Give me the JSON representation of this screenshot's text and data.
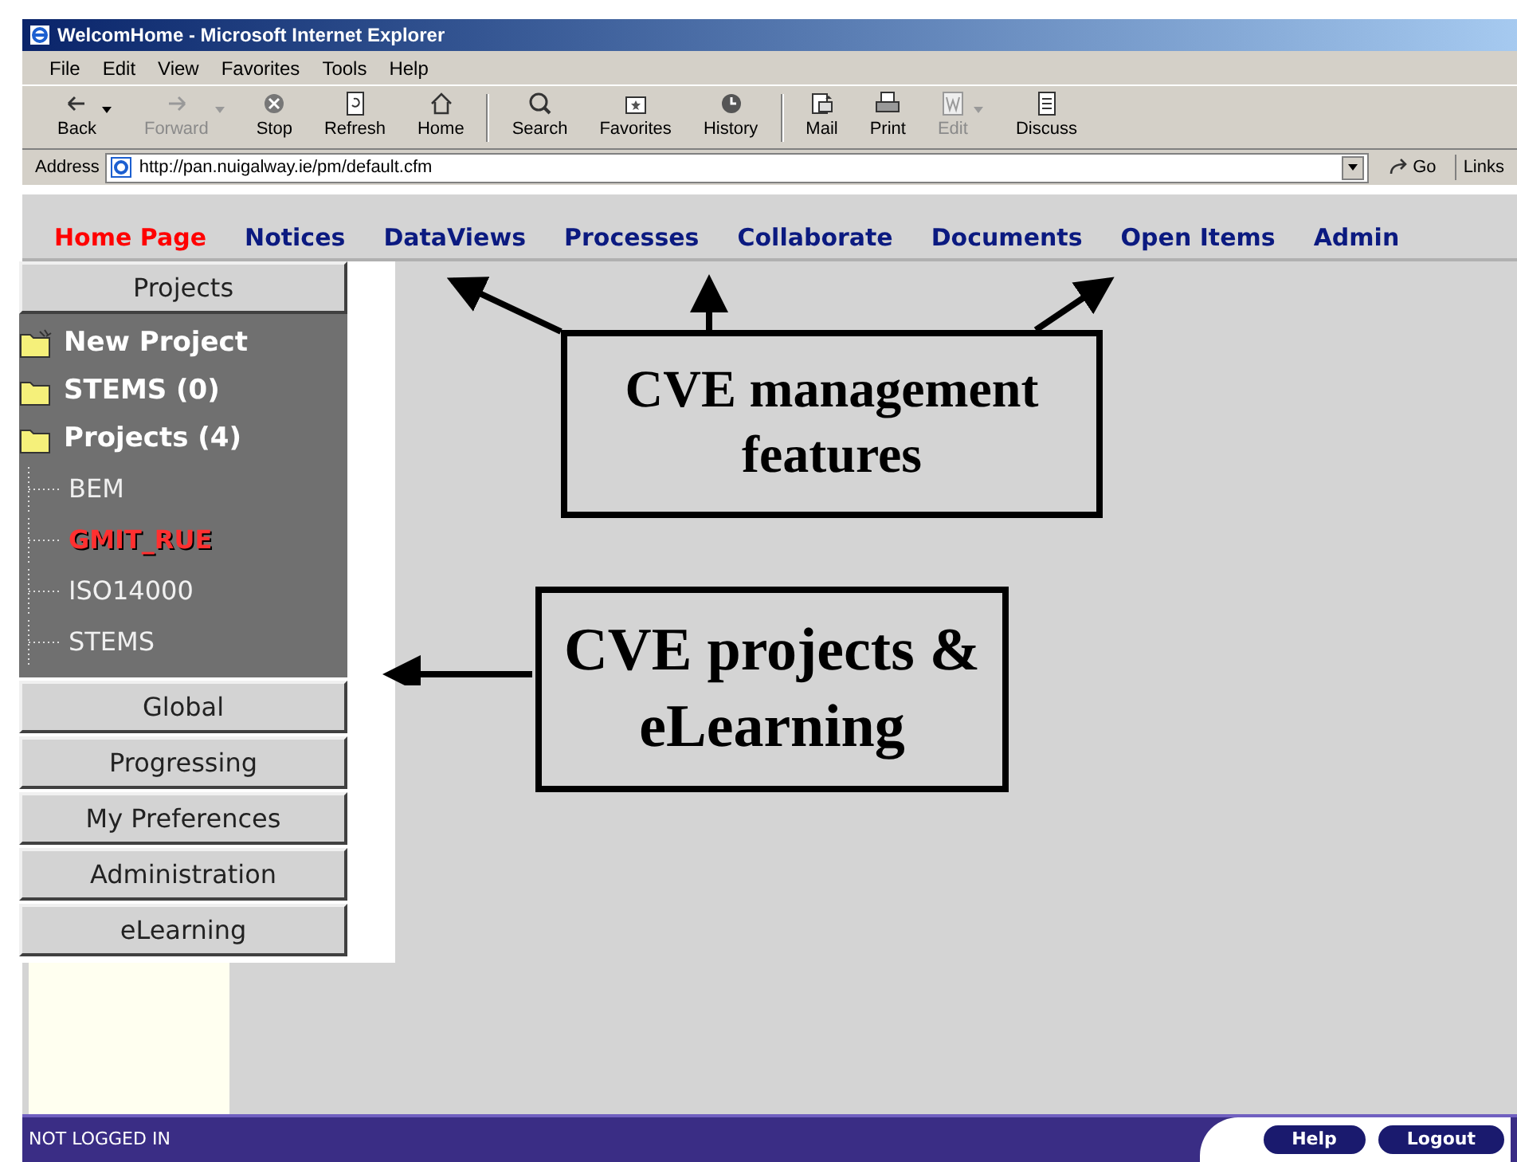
{
  "window": {
    "title": "WelcomHome - Microsoft Internet Explorer"
  },
  "menu": [
    "File",
    "Edit",
    "View",
    "Favorites",
    "Tools",
    "Help"
  ],
  "toolbar": [
    {
      "label": "Back",
      "kind": "back",
      "disabled": false,
      "dropdown": true
    },
    {
      "label": "Forward",
      "kind": "forward",
      "disabled": true,
      "dropdown": true
    },
    {
      "label": "Stop",
      "kind": "stop",
      "disabled": false,
      "dropdown": false
    },
    {
      "label": "Refresh",
      "kind": "refresh",
      "disabled": false,
      "dropdown": false
    },
    {
      "label": "Home",
      "kind": "home",
      "disabled": false,
      "dropdown": false
    },
    {
      "label": "Search",
      "kind": "search",
      "disabled": false,
      "dropdown": false
    },
    {
      "label": "Favorites",
      "kind": "favorites",
      "disabled": false,
      "dropdown": false
    },
    {
      "label": "History",
      "kind": "history",
      "disabled": false,
      "dropdown": false
    },
    {
      "label": "Mail",
      "kind": "mail",
      "disabled": false,
      "dropdown": false
    },
    {
      "label": "Print",
      "kind": "print",
      "disabled": false,
      "dropdown": false
    },
    {
      "label": "Edit",
      "kind": "edit",
      "disabled": true,
      "dropdown": true
    },
    {
      "label": "Discuss",
      "kind": "discuss",
      "disabled": false,
      "dropdown": false
    }
  ],
  "address": {
    "label": "Address",
    "value": "http://pan.nuigalway.ie/pm/default.cfm",
    "go": "Go",
    "links": "Links"
  },
  "nav": [
    {
      "label": "Home Page",
      "selected": true
    },
    {
      "label": "Notices",
      "selected": false
    },
    {
      "label": "DataViews",
      "selected": false
    },
    {
      "label": "Processes",
      "selected": false
    },
    {
      "label": "Collaborate",
      "selected": false
    },
    {
      "label": "Documents",
      "selected": false
    },
    {
      "label": "Open Items",
      "selected": false
    },
    {
      "label": "Admin",
      "selected": false
    }
  ],
  "sidebar": {
    "header": "Projects",
    "items": [
      {
        "label": "New Project",
        "kind": "new-folder"
      },
      {
        "label": "STEMS (0)",
        "kind": "folder"
      },
      {
        "label": "Projects (4)",
        "kind": "folder",
        "children": [
          {
            "label": "BEM",
            "selected": false
          },
          {
            "label": "GMIT_RUE",
            "selected": true
          },
          {
            "label": "ISO14000",
            "selected": false
          },
          {
            "label": "STEMS",
            "selected": false
          }
        ]
      }
    ],
    "sections": [
      "Global",
      "Progressing",
      "My Preferences",
      "Administration",
      "eLearning"
    ]
  },
  "status_bar": {
    "text": "NOT LOGGED IN",
    "buttons": [
      "Help",
      "Logout"
    ]
  },
  "annotations": [
    {
      "text": "CVE management features"
    },
    {
      "text": "CVE projects & eLearning"
    }
  ]
}
